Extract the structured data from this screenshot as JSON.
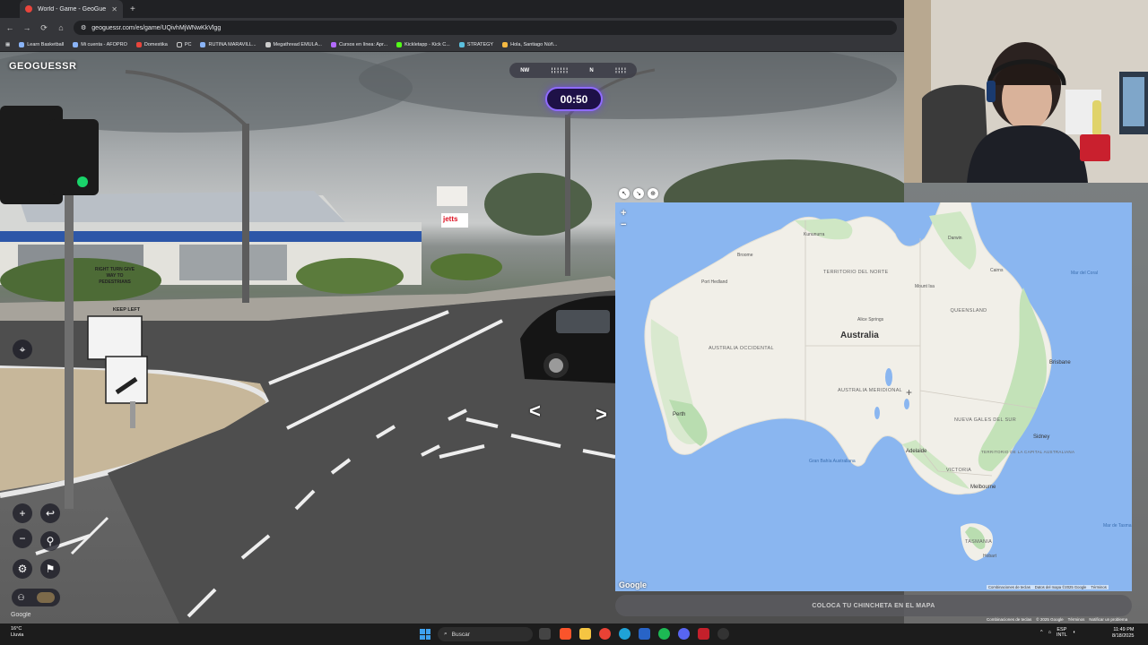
{
  "browser": {
    "tab_title": "World - Game - GeoGuessr",
    "url": "geoguessr.com/es/game/UQivhMjWNwKkVlgg",
    "bookmarks": [
      "Learn Basketball",
      "Mi cuenta - AFOPRO",
      "Domestika",
      "PC",
      "RUTINA MARAVILL...",
      "Megathread EMULA...",
      "Cursos en línea: Apr...",
      "Kickletapp - Kick C...",
      "STRATEGY",
      "Hola, Santiago Núñ..."
    ]
  },
  "game": {
    "logo": "GEOGUESSR",
    "timer": "00:50",
    "compass": {
      "nw": "NW",
      "n": "N"
    },
    "street_signs": {
      "sign1": "RIGHT TURN GIVE WAY TO PEDESTRIANS",
      "sign2": "KEEP LEFT",
      "store_sign": "jetts"
    },
    "google_watermark": "Google"
  },
  "map": {
    "country": "Australia",
    "states": {
      "nt": "TERRITORIO DEL NORTE",
      "wa": "AUSTRALIA OCCIDENTAL",
      "sa": "AUSTRALIA MERIDIONAL",
      "qld": "QUEENSLAND",
      "nsw": "NUEVA GALES DEL SUR",
      "vic": "VICTORIA",
      "tas": "TASMANIA",
      "act": "TERRITORIO DE LA CAPITAL AUSTRALIANA"
    },
    "cities": {
      "perth": "Perth",
      "adelaide": "Adelaide",
      "melbourne": "Melbourne",
      "sidney": "Sidney",
      "brisbane": "Brisbane",
      "darwin": "Darwin",
      "alice": "Alice Springs",
      "broome": "Broome",
      "port_hedland": "Port Hedland",
      "mount_isa": "Mount Isa",
      "cairns": "Cairns",
      "kununurra": "Kununurra",
      "hobart": "Hobart"
    },
    "seas": {
      "coral": "Mar del Coral",
      "bight": "Gran Bahía Australiana",
      "tasman": "Mar de Tasmania"
    },
    "google": "Google",
    "attribution": [
      "Combinaciones de teclas",
      "Datos del mapa ©2025 Google",
      "Términos"
    ],
    "guess_button": "COLOCA TU CHINCHETA EN EL MAPA",
    "zoom_in": "+",
    "zoom_out": "−"
  },
  "bottom_attribution": [
    "Combinaciones de teclas",
    "© 2025 Google",
    "Términos",
    "Notificar un problema"
  ],
  "taskbar": {
    "weather_temp": "16°C",
    "weather_desc": "Lluvia",
    "search_placeholder": "Buscar",
    "lang": "ESP",
    "lang2": "INTL",
    "time": "11:49 PM",
    "date": "8/18/2025"
  },
  "colors": {
    "timer_border": "#8f6bff",
    "ocean": "#8ab6f0",
    "land": "#f1efe8"
  }
}
